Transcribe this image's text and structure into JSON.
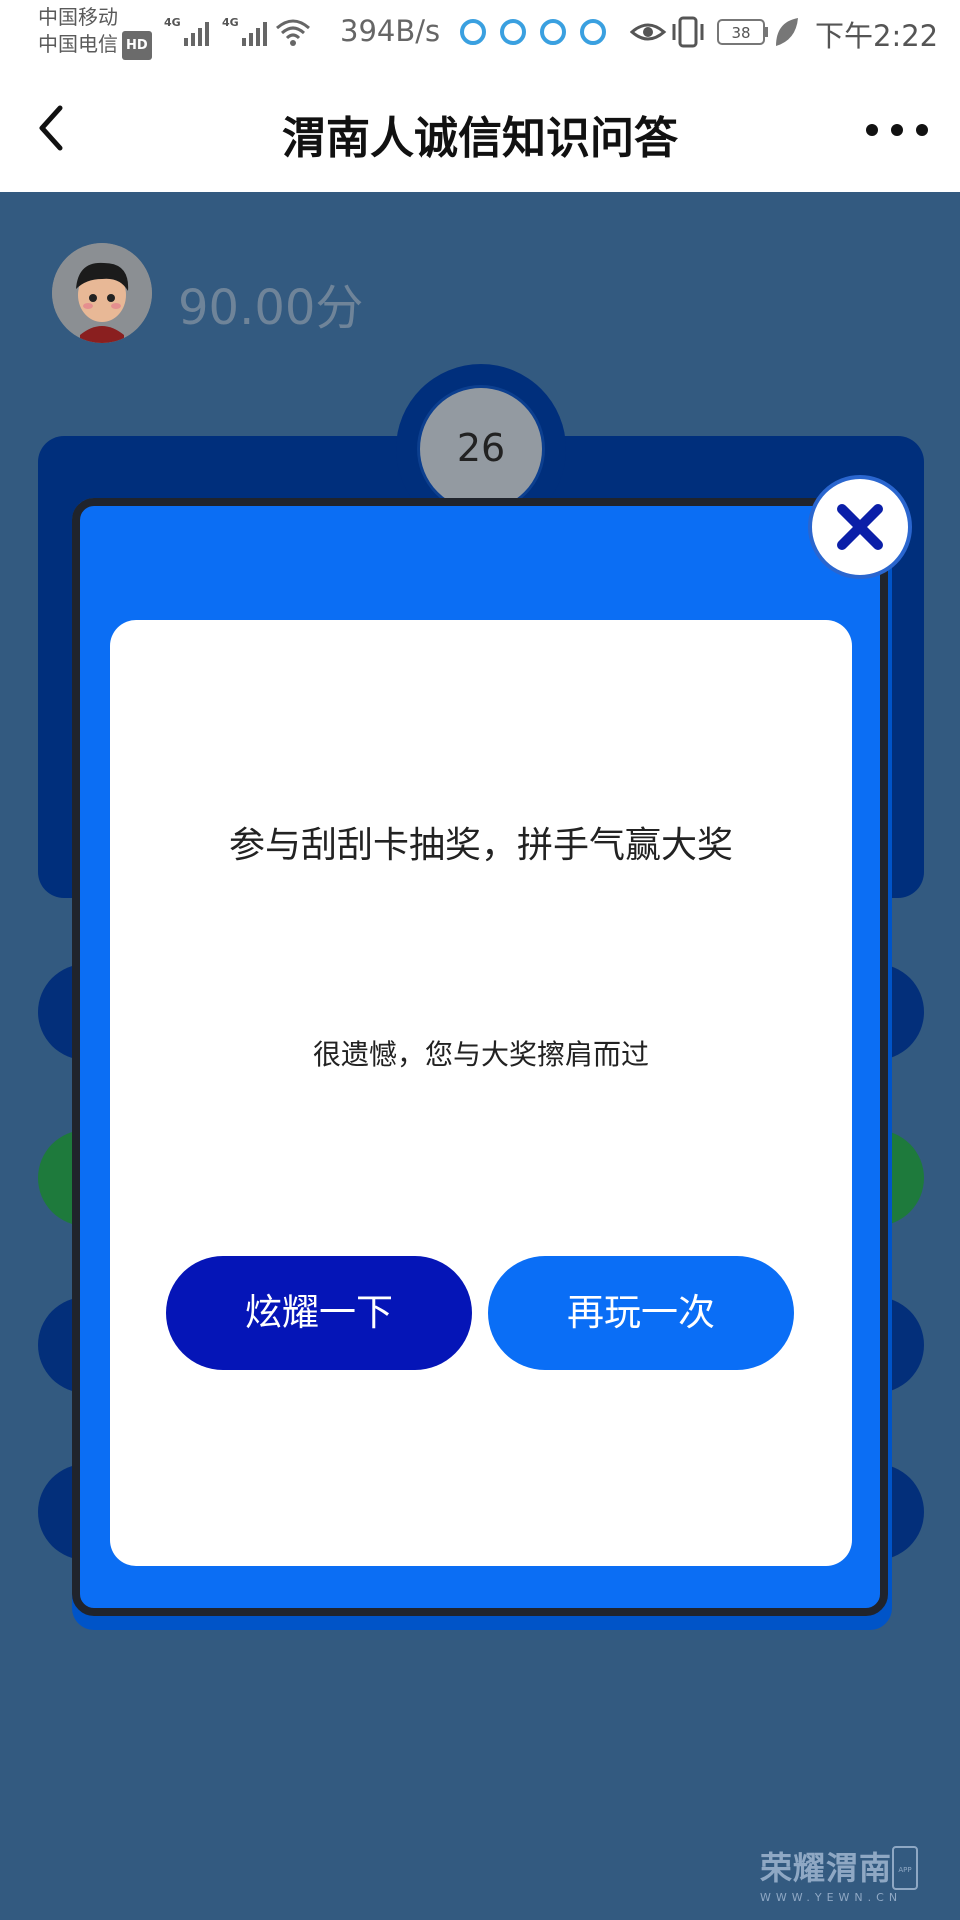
{
  "status_bar": {
    "carrier_1": "中国移动",
    "carrier_2": "中国电信",
    "hd_badge": "HD",
    "network_type_1": "4G",
    "network_type_2": "4G",
    "net_speed": "394B/s",
    "battery": "38",
    "time": "下午2:22"
  },
  "header": {
    "title": "渭南人诚信知识问答",
    "back_icon": "chevron-left-icon",
    "more_icon": "more-horizontal-icon"
  },
  "game": {
    "score": "90.00分",
    "timer": "26"
  },
  "modal": {
    "title": "参与刮刮卡抽奖，拼手气赢大奖",
    "message": "很遗憾，您与大奖擦肩而过",
    "share_button": "炫耀一下",
    "retry_button": "再玩一次",
    "close_icon": "close-icon"
  },
  "watermark": {
    "brand": "荣耀渭南",
    "url": "WWW.YEWN.CN",
    "app_label": "APP"
  },
  "colors": {
    "modal_blue": "#0b6ef4",
    "share_button": "#0515b7",
    "retry_button": "#0a6ef6",
    "page_background": "#335a80"
  }
}
